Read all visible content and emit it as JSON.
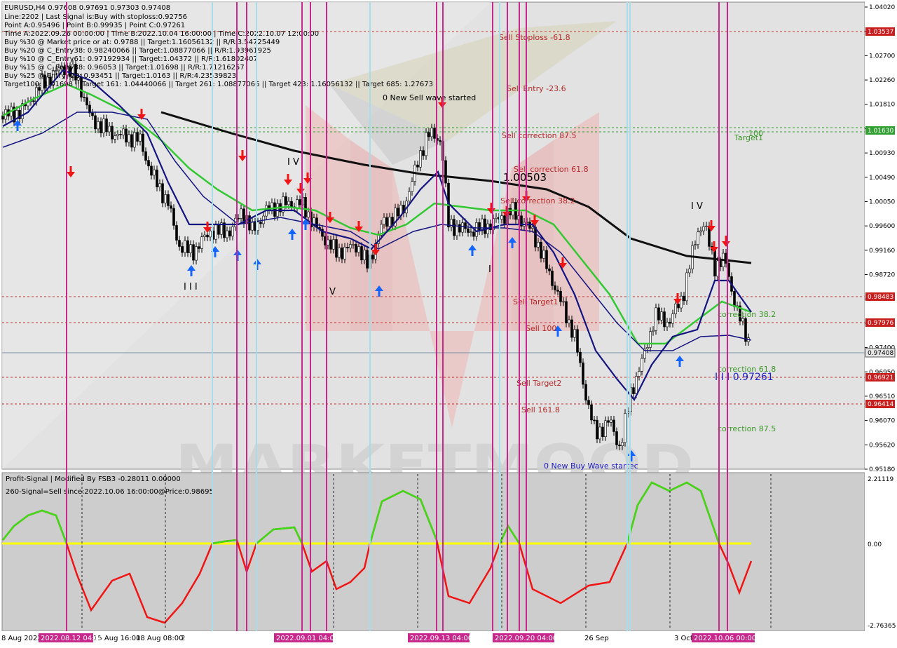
{
  "header": {
    "symbol_line": "EURUSD,H4  0.97608 0.97691 0.97303 0.97408",
    "info_lines": [
      "Line:2202 | Last Signal is:Buy with stoploss:0.92756",
      "Point A:0.95496 | Point B:0.99935 | Point C:0.97261",
      "Time A:2022.09.26 00:00:00 | Time B:2022.10.04 16:00:00 | Time C:2022.10.07 12:00:00",
      "Buy %30 @ Market price or at: 0.9788 || Target:1.16056132 || R/R:3.54725449",
      "Buy %20 @ C_Entry38: 0.98240066 || Target:1.08877066 || R/R:1.93961925",
      "Buy %10 @ C_Entry61: 0.97192934 || Target:1.04372 || R/R:1.61802407",
      "Buy %15 @ C_Entry88: 0.96053 || Target:1.01698 || R/R:1.71216257",
      "Buy %25 @ Entry -23: 0.93451 || Target:1.0163 || R/R:4.23539823",
      "Target100: 1.01698 || Target 161: 1.04440066 || Target 261: 1.08877066 || Target 423: 1.16056132 || Target 685: 1.27673"
    ]
  },
  "price_axis": {
    "ticks": [
      "1.04020",
      "1.03110",
      "1.02700",
      "1.02260",
      "1.01810",
      "1.01370",
      "1.00930",
      "1.00490",
      "1.00050",
      "0.99600",
      "0.99160",
      "0.98720",
      "0.98280",
      "0.97840",
      "0.97400",
      "0.96950",
      "0.96510",
      "0.96070",
      "0.95620",
      "0.95180"
    ],
    "tag_stoploss": "1.03537",
    "tag_target": "1.01630",
    "tag_r1": "0.98483",
    "tag_r2": "0.97976",
    "tag_current": "0.97408",
    "tag_s1": "0.96921",
    "tag_s2": "0.96414"
  },
  "annotations": {
    "sell_stoploss": "Sell Stoploss -61.8",
    "sell_entry": "Sell Entry -23.6",
    "new_sell_wave": "0 New Sell wave started",
    "sell_correction_875": "Sell correction 87.5",
    "sell_correction_618": "Sell correction 61.8",
    "sell_correction_382": "Sell correction 38.2",
    "level_value": "1.00503",
    "sell_target1": "Sell Target1",
    "sell_100": "Sell 100",
    "sell_target2": "Sell Target2",
    "sell_1618": "Sell 161.8",
    "new_buy_wave": "0 New Buy Wave startec",
    "target1_100": "100",
    "target1": "Target1",
    "correction_382": "correction 38.2",
    "correction_618": "correction 61.8",
    "correction_875": "correction 87.5",
    "point_c_value": "I I I 0.97261",
    "wave_iv_a": "I V",
    "wave_iv_b": "I V",
    "wave_iii": "I I I",
    "wave_v": "V",
    "wave_i": "I",
    "watermark": "MARKETMOOD"
  },
  "indicator": {
    "title": "Profit-Signal | Modified By FSB3 -0.28011 0.00000",
    "signal_line": "260-Signal=Sell since:2022.10.06 16:00:00@Price:0.98695",
    "axis_top": "2.21119",
    "axis_zero": "0.00",
    "axis_bottom": "-2.76365"
  },
  "time_axis": {
    "labels": [
      "8 Aug 2022",
      "15 Aug 16:00",
      "18 Aug 08:00",
      "2",
      "26 Sep",
      "3 Oct"
    ],
    "highlights": [
      "2022.08.12 04:00",
      "2022.09.01 04:00",
      "2022.09.13 04:00",
      "2022.09.20 04:00",
      "2022.10.06 00:00"
    ]
  },
  "colors": {
    "background": "#ffffff",
    "main_panel": "#e2e2e2",
    "magenta_line": "#c8288c",
    "cyan_line": "#a8dce8",
    "ma_black": "#101010",
    "ma_green": "#32c832",
    "ma_navy": "#141480",
    "sell_red": "#b02828",
    "buy_green": "#3c8c28",
    "osc_green": "#3cdc14",
    "osc_red": "#f01414",
    "zero_yellow": "#ffff00",
    "tag_red": "#c81e1e",
    "tag_green": "#32a032"
  }
}
